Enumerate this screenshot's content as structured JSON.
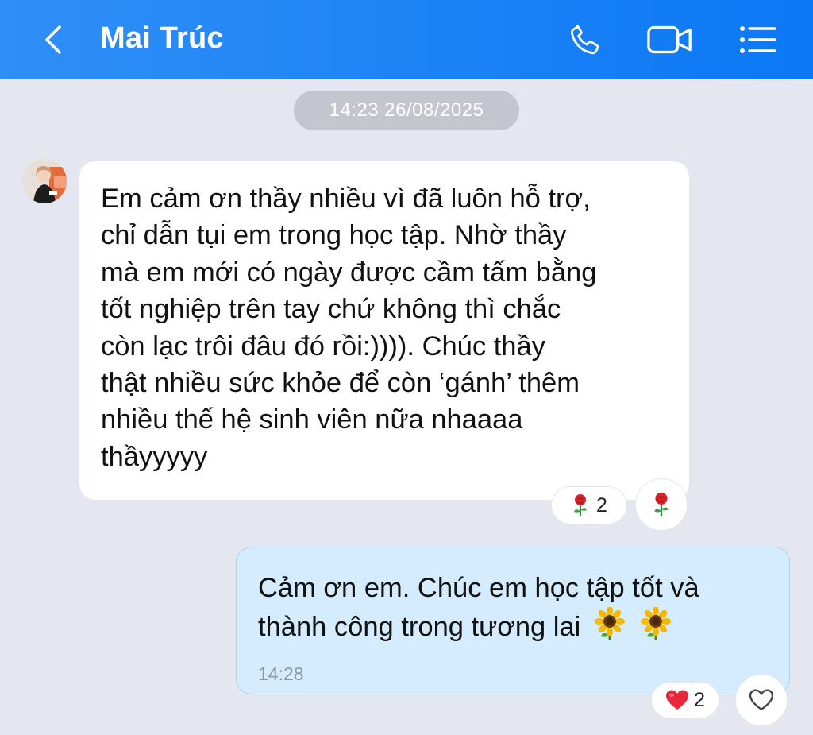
{
  "header": {
    "contact_name": "Mai Trúc",
    "icons": [
      "chevron-left-icon",
      "phone-icon",
      "video-camera-icon",
      "list-menu-icon"
    ],
    "background": "#0c78f5"
  },
  "conversation": {
    "timestamp": "14:23 26/08/2025",
    "incoming": {
      "lines": [
        "Em cảm ơn thầy nhiều vì đã luôn hỗ trợ,",
        "chỉ dẫn tụi em trong học tập. Nhờ thầy",
        "mà em mới có ngày được cầm tấm bằng",
        "tốt nghiệp trên tay chứ không thì chắc",
        "còn lạc trôi đâu đó rồi:)))). Chúc thầy",
        "thật nhiều sức khỏe để còn ‘gánh’ thêm",
        "nhiều thế hệ sinh viên nữa nhaaaa",
        "thầyyyyy"
      ],
      "reaction": {
        "icon": "rose-icon",
        "count": "2"
      },
      "react_button_icon": "rose-icon"
    },
    "outgoing": {
      "lines": [
        "Cảm ơn em. Chúc em học tập tốt và",
        "thành công trong tương lai"
      ],
      "emojis": [
        "sunflower-icon",
        "sunflower-icon"
      ],
      "time": "14:28",
      "reaction": {
        "icon": "heart-icon",
        "count": "2"
      },
      "react_button_icon": "heart-outline-icon",
      "bubble_color": "#d4ecfd"
    }
  }
}
